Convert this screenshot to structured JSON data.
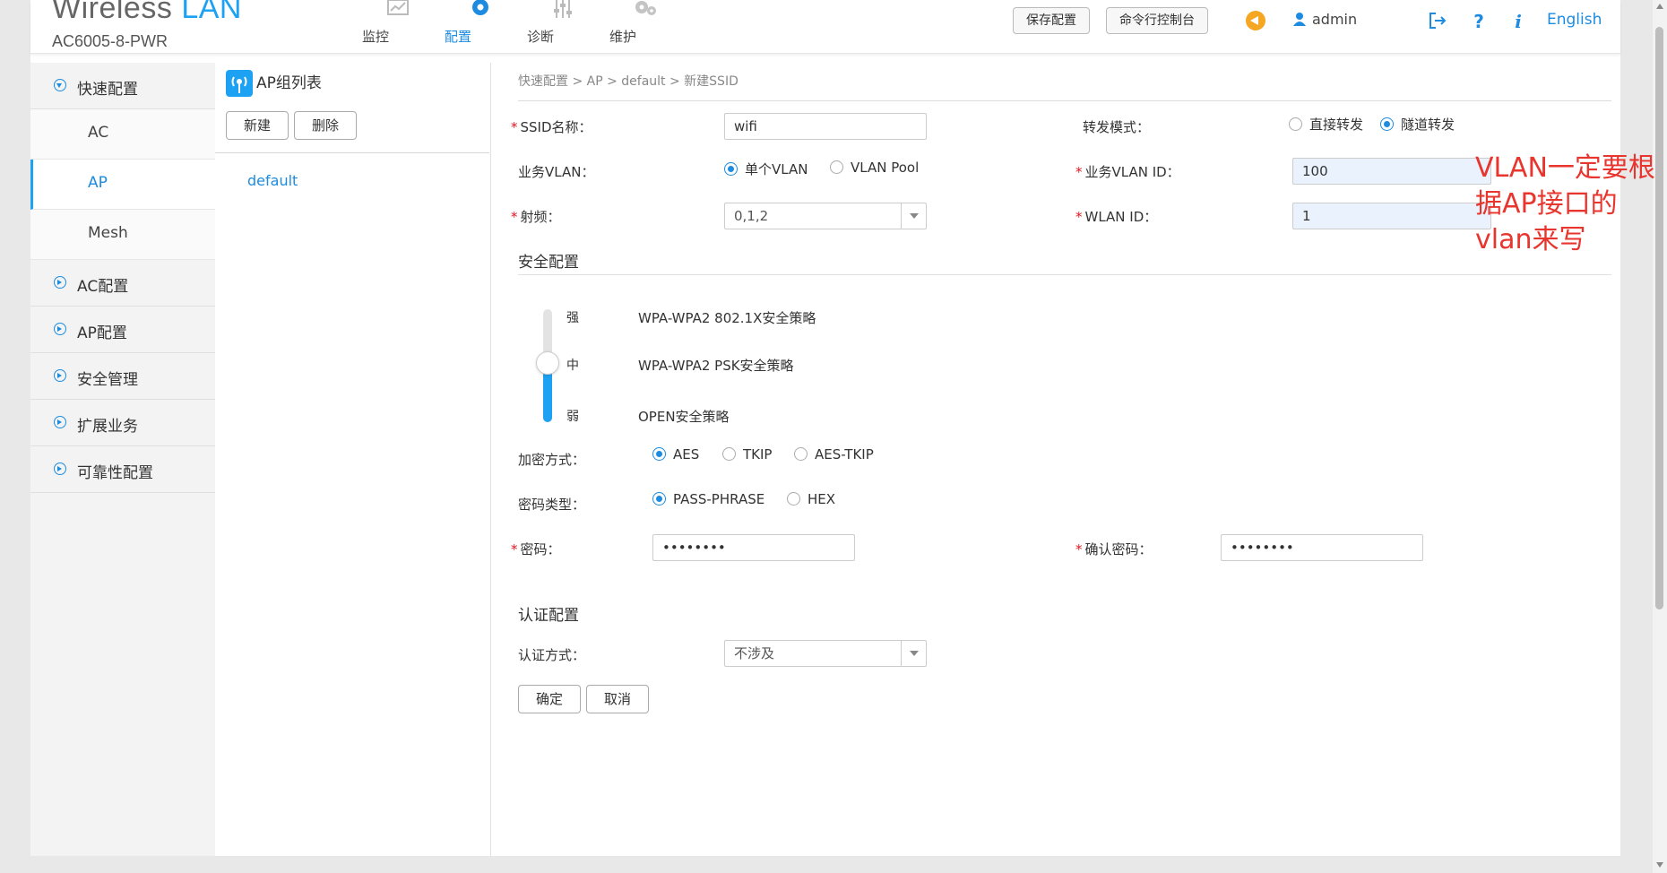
{
  "header": {
    "brand_main": "Wireless",
    "brand_accent": "LAN",
    "model": "AC6005-8-PWR",
    "nav": [
      {
        "label": "监控",
        "icon": "monitor-icon"
      },
      {
        "label": "配置",
        "icon": "gear-icon"
      },
      {
        "label": "诊断",
        "icon": "diagnose-icon"
      },
      {
        "label": "维护",
        "icon": "maintenance-icon"
      }
    ],
    "save_label": "保存配置",
    "cli_label": "命令行控制台",
    "user": "admin",
    "language": "English"
  },
  "sidebar": {
    "items": [
      {
        "label": "快速配置",
        "open": true
      },
      {
        "label": "AC配置"
      },
      {
        "label": "AP配置"
      },
      {
        "label": "安全管理"
      },
      {
        "label": "扩展业务"
      },
      {
        "label": "可靠性配置"
      }
    ],
    "subitems": [
      {
        "label": "AC"
      },
      {
        "label": "AP",
        "active": true
      },
      {
        "label": "Mesh"
      }
    ]
  },
  "midpanel": {
    "title": "AP组列表",
    "new_label": "新建",
    "delete_label": "删除",
    "groups": [
      "default"
    ]
  },
  "form": {
    "breadcrumb": "快速配置 > AP > default > 新建SSID",
    "ssid_label": "SSID名称：",
    "ssid_value": "wifi",
    "forward_label": "转发模式：",
    "forward_options": [
      "直接转发",
      "隧道转发"
    ],
    "forward_selected": "隧道转发",
    "vlan_label": "业务VLAN：",
    "vlan_options": [
      "单个VLAN",
      "VLAN Pool"
    ],
    "vlan_selected": "单个VLAN",
    "vlan_id_label": "业务VLAN ID：",
    "vlan_id_value": "100",
    "radio_label": "射频：",
    "radio_value": "0,1,2",
    "wlan_id_label": "WLAN ID：",
    "wlan_id_value": "1",
    "security_title": "安全配置",
    "security_levels": [
      "强",
      "中",
      "弱"
    ],
    "security_policies": [
      "WPA-WPA2 802.1X安全策略",
      "WPA-WPA2 PSK安全策略",
      "OPEN安全策略"
    ],
    "security_selected": "中",
    "encrypt_label": "加密方式：",
    "encrypt_options": [
      "AES",
      "TKIP",
      "AES-TKIP"
    ],
    "encrypt_selected": "AES",
    "pwtype_label": "密码类型：",
    "pwtype_options": [
      "PASS-PHRASE",
      "HEX"
    ],
    "pwtype_selected": "PASS-PHRASE",
    "password_label": "密码：",
    "password_value": "••••••••",
    "confirm_label": "确认密码：",
    "confirm_value": "••••••••",
    "auth_title": "认证配置",
    "auth_label": "认证方式：",
    "auth_value": "不涉及",
    "ok_label": "确定",
    "cancel_label": "取消"
  },
  "annotation": "VLAN一定要根据AP接口的vlan来写",
  "colors": {
    "accent": "#1d8ce0",
    "required": "#e6141e",
    "note": "#e8352e"
  }
}
